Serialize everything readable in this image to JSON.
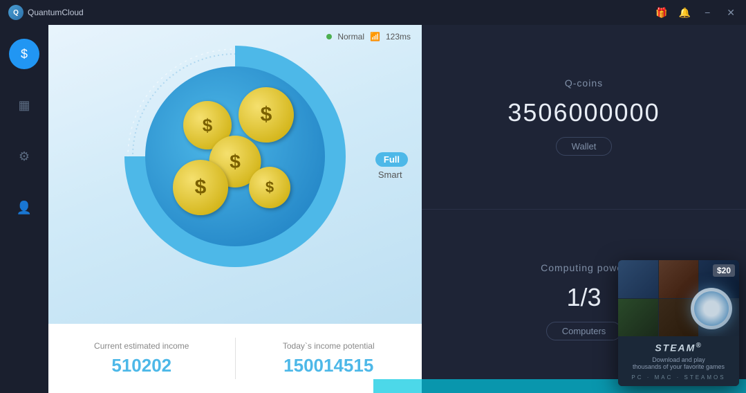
{
  "app": {
    "title": "QuantumCloud"
  },
  "titlebar": {
    "gift_icon": "🎁",
    "bell_icon": "🔔",
    "minimize": "−",
    "close": "✕"
  },
  "sidebar": {
    "items": [
      {
        "id": "wallet",
        "icon": "$",
        "active": true
      },
      {
        "id": "stats",
        "icon": "▦",
        "active": false
      },
      {
        "id": "settings",
        "icon": "⚙",
        "active": false
      },
      {
        "id": "profile",
        "icon": "👤",
        "active": false
      }
    ]
  },
  "status": {
    "mode": "Normal",
    "ping": "123ms"
  },
  "gauge": {
    "mode_full": "Full",
    "mode_smart": "Smart"
  },
  "income": {
    "current_label": "Current estimated income",
    "current_value": "510202",
    "potential_label": "Today`s income potential",
    "potential_value": "150014515"
  },
  "qcoins": {
    "label": "Q-coins",
    "value": "3506000000",
    "wallet_btn": "Wallet"
  },
  "computing": {
    "label": "Computing power",
    "value": "1/3",
    "computers_btn": "Computers"
  },
  "steam": {
    "price": "$20",
    "title": "STEAM",
    "trademark": "®",
    "subtitle": "Download and play\nthousands of your favorite games",
    "platforms": "PC · MAC · STEAMOS"
  }
}
